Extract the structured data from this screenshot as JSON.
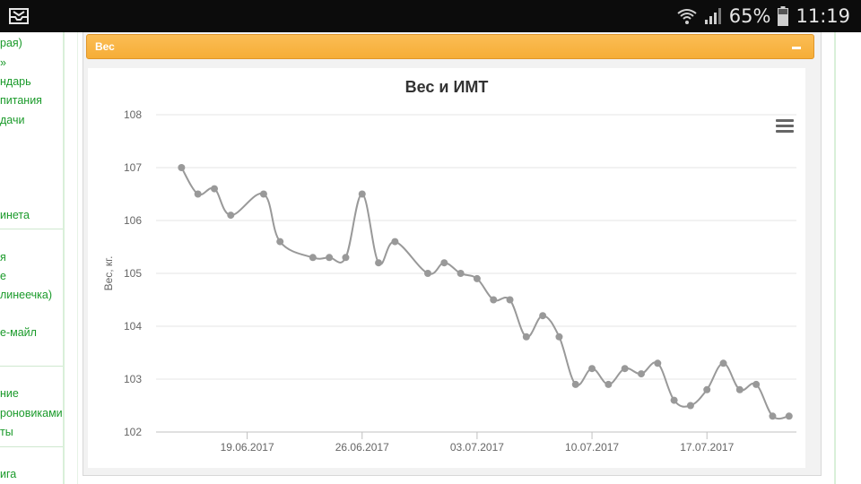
{
  "status_bar": {
    "battery_percent": "65%",
    "time": "11:19",
    "icons": [
      "inbox-icon",
      "wifi-icon",
      "signal-icon",
      "battery-icon"
    ]
  },
  "sidebar": {
    "links": [
      "рая)",
      "»",
      "ндарь",
      " питания",
      "дачи",
      "инета",
      "я",
      "е",
      "линеечка)",
      "е-майл",
      "ние",
      "роновиками",
      "ты",
      "ига"
    ]
  },
  "widget": {
    "title": "Вес",
    "header_color": "#f6ad36"
  },
  "chart_data": {
    "type": "line",
    "title": "Вес и ИМТ",
    "ylabel": "Вес, кг.",
    "xlabel": "",
    "ylim": [
      102,
      108
    ],
    "yticks": [
      102,
      103,
      104,
      105,
      106,
      107,
      108
    ],
    "xticks": [
      "19.06.2017",
      "26.06.2017",
      "03.07.2017",
      "10.07.2017",
      "17.07.2017"
    ],
    "x_range": [
      "2017-06-14",
      "2017-07-22"
    ],
    "grid": true,
    "menu_icon": "hamburger-icon",
    "series": [
      {
        "color": "#999999",
        "points": [
          [
            "2017-06-15",
            107.0
          ],
          [
            "2017-06-16",
            106.5
          ],
          [
            "2017-06-17",
            106.6
          ],
          [
            "2017-06-18",
            106.1
          ],
          [
            "2017-06-20",
            106.5
          ],
          [
            "2017-06-21",
            105.6
          ],
          [
            "2017-06-23",
            105.3
          ],
          [
            "2017-06-24",
            105.3
          ],
          [
            "2017-06-25",
            105.3
          ],
          [
            "2017-06-26",
            106.5
          ],
          [
            "2017-06-27",
            105.2
          ],
          [
            "2017-06-28",
            105.6
          ],
          [
            "2017-06-30",
            105.0
          ],
          [
            "2017-07-01",
            105.2
          ],
          [
            "2017-07-02",
            105.0
          ],
          [
            "2017-07-03",
            104.9
          ],
          [
            "2017-07-04",
            104.5
          ],
          [
            "2017-07-05",
            104.5
          ],
          [
            "2017-07-06",
            103.8
          ],
          [
            "2017-07-07",
            104.2
          ],
          [
            "2017-07-08",
            103.8
          ],
          [
            "2017-07-09",
            102.9
          ],
          [
            "2017-07-10",
            103.2
          ],
          [
            "2017-07-11",
            102.9
          ],
          [
            "2017-07-12",
            103.2
          ],
          [
            "2017-07-13",
            103.1
          ],
          [
            "2017-07-14",
            103.3
          ],
          [
            "2017-07-15",
            102.6
          ],
          [
            "2017-07-16",
            102.5
          ],
          [
            "2017-07-17",
            102.8
          ],
          [
            "2017-07-18",
            103.3
          ],
          [
            "2017-07-19",
            102.8
          ],
          [
            "2017-07-20",
            102.9
          ],
          [
            "2017-07-21",
            102.3
          ],
          [
            "2017-07-22",
            102.3
          ]
        ]
      }
    ]
  }
}
